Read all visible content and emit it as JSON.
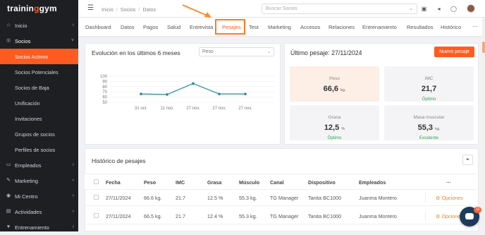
{
  "app": {
    "logo": "traininggym",
    "accent": "#ff5a1f"
  },
  "sidebar": {
    "items": [
      {
        "label": "Inicio",
        "icon": "home-icon",
        "chevron": "›"
      },
      {
        "label": "Socios",
        "icon": "socios-icon",
        "chevron": "˅",
        "open": true
      },
      {
        "label": "Empleados",
        "icon": "employees-icon",
        "chevron": "›"
      },
      {
        "label": "Marketing",
        "icon": "marketing-icon",
        "chevron": "›"
      },
      {
        "label": "Mi Centro",
        "icon": "location-icon",
        "chevron": "›"
      },
      {
        "label": "Actividades",
        "icon": "activities-icon",
        "chevron": "›"
      },
      {
        "label": "Entrenamiento",
        "icon": "training-icon",
        "chevron": "›"
      }
    ],
    "subitems": [
      "Socios Activos",
      "Socios Potenciales",
      "Socios de Baja",
      "Unificación",
      "Invitaciones",
      "Grupos de socios",
      "Perfiles de socios"
    ]
  },
  "topbar": {
    "breadcrumb": [
      "Inicio",
      "Socios",
      "Datos"
    ],
    "search_placeholder": "Buscar Socios"
  },
  "tabs": [
    "Dashboard",
    "Datos",
    "Pagos",
    "Salud",
    "Entrevista",
    "Pesajes",
    "Test",
    "Marketing",
    "Accesos",
    "Relaciones",
    "Entrenamiento",
    "Resultados",
    "Histórico"
  ],
  "active_tab": "Pesajes",
  "evolution": {
    "title": "Evolución en los últimos 6 meses",
    "select_value": "Peso"
  },
  "chart_data": {
    "type": "line",
    "categories": [
      "31 oct.",
      "11 nov.",
      "27 nov.",
      "27 nov.",
      "27 nov."
    ],
    "values": [
      66,
      65,
      86,
      66,
      66
    ],
    "yticks": [
      50,
      60,
      70,
      80,
      90,
      100
    ],
    "ylim": [
      50,
      100
    ],
    "color": "#1f8a9e",
    "grid": true
  },
  "last_weigh": {
    "title": "Último pesaje: 27/11/2024",
    "button": "Nuevo pesaje",
    "stats": [
      {
        "label": "Peso",
        "value": "66,6",
        "unit": "kg.",
        "status": "",
        "bg": "#fdeee6"
      },
      {
        "label": "IMC",
        "value": "21,7",
        "unit": "",
        "status": "Óptimo",
        "bg": "#f4f4f6"
      },
      {
        "label": "Grasa",
        "value": "12,5",
        "unit": "%",
        "status": "Óptimo",
        "bg": "#f4f4f6"
      },
      {
        "label": "Masa muscular",
        "value": "55,3",
        "unit": "kg.",
        "status": "Excelente",
        "bg": "#f4f4f6"
      }
    ]
  },
  "history": {
    "title": "Histórico de pesajes",
    "columns": [
      "Fecha",
      "Peso",
      "IMC",
      "Grasa",
      "Músculo",
      "Canal",
      "Dispositivo",
      "Empleados",
      "···"
    ],
    "rows": [
      {
        "fecha": "27/11/2024",
        "peso": "66.6 kg.",
        "imc": "21.7",
        "grasa": "12.5 %",
        "musculo": "55.3 kg.",
        "canal": "TG Manager",
        "dispositivo": "Tanita BC1000",
        "empleado": "Juanma Montero",
        "accion": "Opciones"
      },
      {
        "fecha": "27/11/2024",
        "peso": "66.5 kg.",
        "imc": "21.7",
        "grasa": "12.4 %",
        "musculo": "55.3 kg.",
        "canal": "TG Manager",
        "dispositivo": "Tanita BC1000",
        "empleado": "Juanma Montero",
        "accion": "Opciones"
      }
    ]
  },
  "chat": {
    "badge": "12"
  }
}
